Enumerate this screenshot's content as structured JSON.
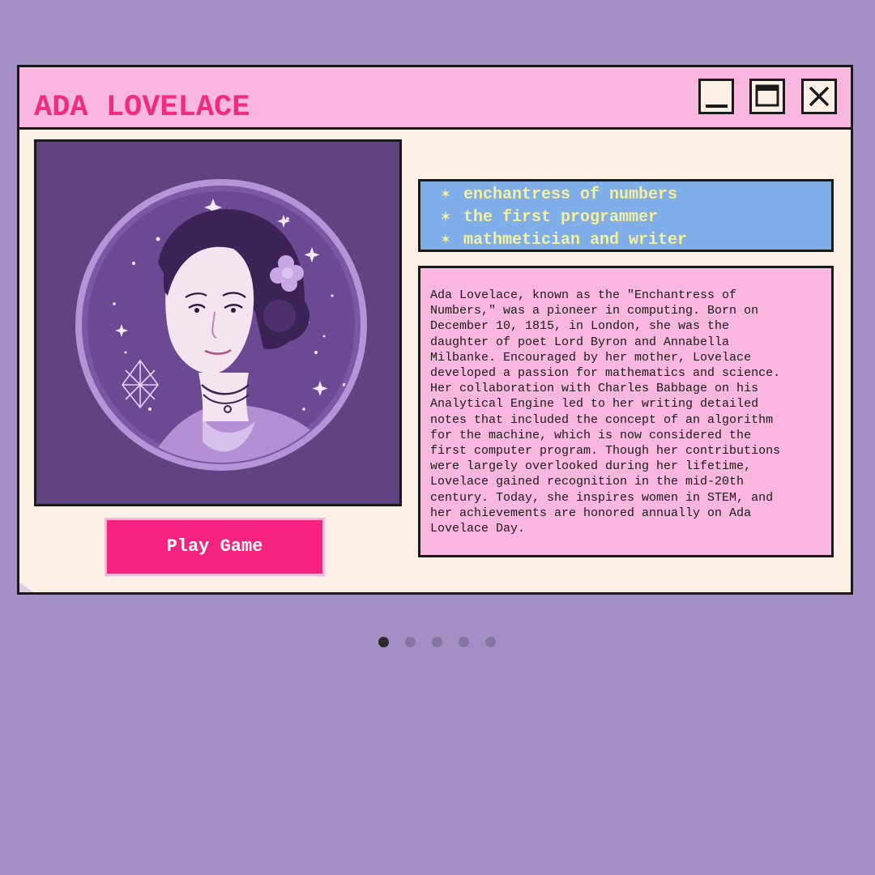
{
  "window": {
    "title": "ADA LOVELACE",
    "controls": {
      "minimize_icon": "minimize-icon",
      "maximize_icon": "maximize-icon",
      "close_icon": "close-icon"
    }
  },
  "portrait": {
    "icon": "ada-lovelace-portrait-illustration"
  },
  "play_button": {
    "label": "Play Game"
  },
  "taglines": [
    {
      "star": "✶",
      "text": "enchantress of numbers"
    },
    {
      "star": "✶",
      "text": "the first programmer"
    },
    {
      "star": "✶",
      "text": "mathmetician and writer"
    }
  ],
  "bio": {
    "text": "Ada Lovelace, known as the \"Enchantress of\nNumbers,\" was a pioneer in computing. Born on\nDecember 10, 1815, in London, she was the\ndaughter of poet Lord Byron and Annabella\nMilbanke. Encouraged by her mother, Lovelace\ndeveloped a passion for mathematics and science.\nHer collaboration with Charles Babbage on his\nAnalytical Engine led to her writing detailed\nnotes that included the concept of an algorithm\nfor the machine, which is now considered the\nfirst computer program. Though her contributions\nwere largely overlooked during her lifetime,\nLovelace gained recognition in the mid-20th\ncentury. Today, she inspires women in STEM, and\nher achievements are honored annually on Ada\nLovelace Day."
  },
  "pagination": {
    "total": 5,
    "active": 1
  },
  "colors": {
    "background": "#a48fc4",
    "window_bg": "#fcefe6",
    "titlebar": "#f9b6df",
    "title_text": "#ef2c82",
    "button": "#f5237f",
    "tagline_bg": "#80aee8",
    "tagline_text": "#f5f09a",
    "bio_bg": "#f9b6df",
    "portrait_bg": "#5f4481"
  }
}
